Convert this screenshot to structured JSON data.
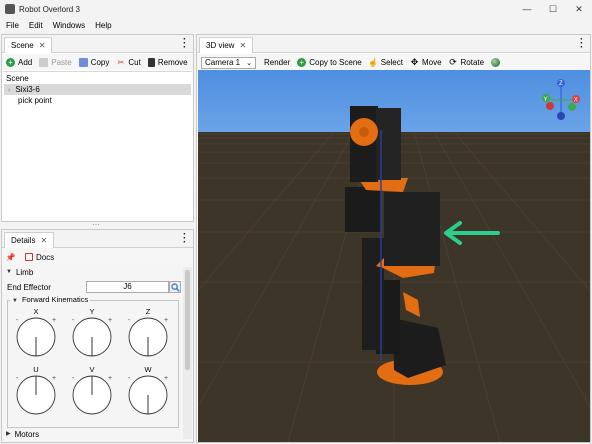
{
  "window": {
    "title": "Robot Overlord 3",
    "controls": [
      "—",
      "☐",
      "✕"
    ]
  },
  "menu": [
    "File",
    "Edit",
    "Windows",
    "Help"
  ],
  "scene_panel": {
    "tab_label": "Scene",
    "close": "✕",
    "toolbar": {
      "add": "Add",
      "paste": "Paste",
      "copy": "Copy",
      "cut": "Cut",
      "remove": "Remove"
    },
    "tree": {
      "root": "Scene",
      "items": [
        {
          "label": "Sixi3-6",
          "selected": true
        },
        {
          "label": "pick point",
          "selected": false
        }
      ]
    }
  },
  "details_panel": {
    "tab_label": "Details",
    "close": "✕",
    "docs_label": "Docs",
    "limb_section": "Limb",
    "end_effector_label": "End Effector",
    "end_effector_value": "J6",
    "fk_section": "Forward Kinematics",
    "dials": [
      {
        "label": "X",
        "angle_deg": 90
      },
      {
        "label": "Y",
        "angle_deg": 90
      },
      {
        "label": "Z",
        "angle_deg": 90
      },
      {
        "label": "U",
        "angle_deg": 270
      },
      {
        "label": "V",
        "angle_deg": 270
      },
      {
        "label": "W",
        "angle_deg": 90
      }
    ],
    "plus": "+",
    "minus": "-",
    "motors_section": "Motors"
  },
  "view_panel": {
    "tab_label": "3D view",
    "close": "✕",
    "toolbar": {
      "camera_value": "Camera 1",
      "render": "Render",
      "copy_to_scene": "Copy to Scene",
      "select": "Select",
      "move": "Move",
      "rotate": "Rotate"
    },
    "gizmo_labels": {
      "y": "Y",
      "x": "X",
      "z": "Z"
    },
    "colors": {
      "sky": "#5b97e4",
      "ground": "#3d3528",
      "robot_body": "#1c1c1c",
      "robot_accent": "#e36d12",
      "arrow": "#2bcf8d",
      "gizmo_x": "#d94040",
      "gizmo_y": "#3fa84b",
      "gizmo_z": "#3a5fd9"
    }
  },
  "icons": {
    "add": "plus-circle-icon",
    "paste": "clipboard-icon",
    "copy": "copy-icon",
    "cut": "scissors-icon",
    "remove": "trash-icon",
    "docs": "book-icon",
    "pin": "pin-icon",
    "search": "search-icon",
    "render": "render-icon",
    "select": "hand-icon",
    "move": "move-icon",
    "rotate": "rotate-icon",
    "sphere": "sphere-icon"
  }
}
